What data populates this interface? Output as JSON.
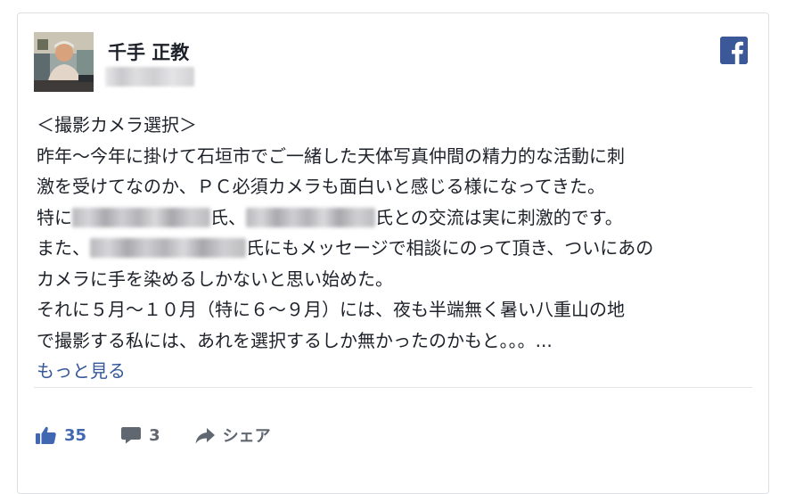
{
  "author": {
    "name": "千手 正教",
    "timestamp": "",
    "avatar_alt": "author-photo"
  },
  "brand": {
    "icon": "facebook-icon",
    "color": "#3b5998"
  },
  "post": {
    "lines": [
      [
        {
          "t": "＜撮影カメラ選択＞"
        }
      ],
      [
        {
          "t": "昨年〜今年に掛けて石垣市でご一緒した天体写真仲間の精力的な活動に刺"
        }
      ],
      [
        {
          "t": "激を受けてなのか、ＰＣ必須カメラも面白いと感じる様になってきた。"
        }
      ],
      [
        {
          "t": "特に"
        },
        {
          "blur": 155
        },
        {
          "t": "氏、"
        },
        {
          "blur": 145
        },
        {
          "t": "氏との交流は実に刺激的です。"
        }
      ],
      [
        {
          "t": "また、"
        },
        {
          "blur": 175
        },
        {
          "t": "氏にもメッセージで相談にのって頂き、ついにあの"
        }
      ],
      [
        {
          "t": "カメラに手を染めるしかないと思い始めた。"
        }
      ],
      [
        {
          "t": "それに５月〜１０月（特に６〜９月）には、夜も半端無く暑い八重山の地"
        }
      ],
      [
        {
          "t": "で撮影する私には、あれを選択するしか無かったのかもと。。。..."
        }
      ]
    ],
    "see_more": "もっと見る"
  },
  "actions": {
    "like_count": "35",
    "comment_count": "3",
    "share_label": "シェア",
    "like_color": "#4267b2",
    "muted_color": "#606770"
  }
}
